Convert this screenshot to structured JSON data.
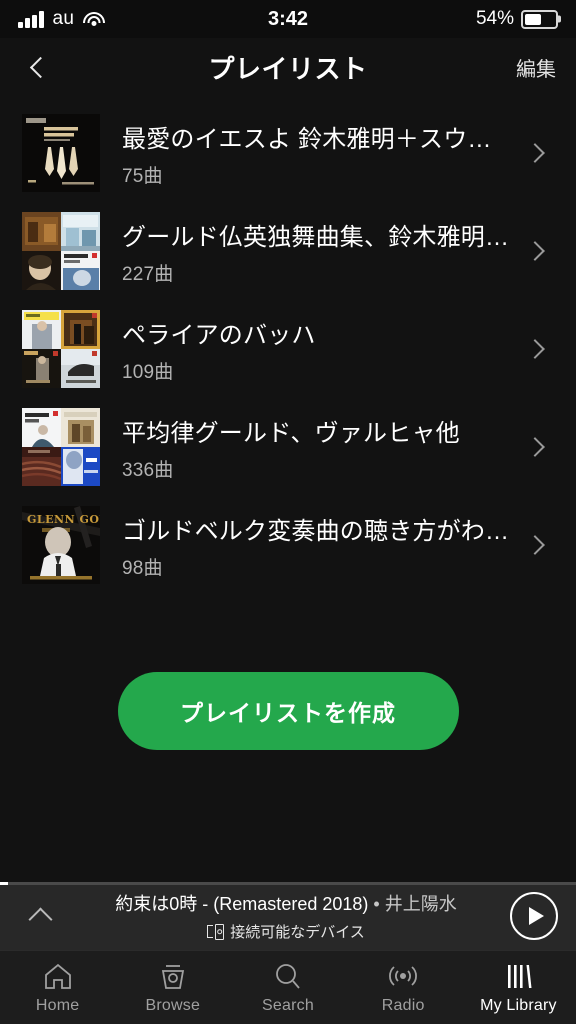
{
  "status_bar": {
    "carrier": "au",
    "time": "3:42",
    "battery_percent": "54%",
    "signal_icon": "signal-bars-icon",
    "wifi_icon": "wifi-icon",
    "battery_icon": "battery-icon"
  },
  "header": {
    "title": "プレイリスト",
    "back_icon": "chevron-left-icon",
    "edit_label": "編集"
  },
  "playlists": [
    {
      "title": "最愛のイエスよ 鈴木雅明＋スウ…",
      "tracks": "75曲",
      "cover": "organ-pipes-cover"
    },
    {
      "title": "グールド仏英独舞曲集、鈴木雅明…",
      "tracks": "227曲",
      "cover": "four-album-collage"
    },
    {
      "title": "ペライアのバッハ",
      "tracks": "109曲",
      "cover": "four-album-collage"
    },
    {
      "title": "平均律グールド、ヴァルヒャ他",
      "tracks": "336曲",
      "cover": "four-album-collage"
    },
    {
      "title": "ゴルドベルク変奏曲の聴き方がわ…",
      "tracks": "98曲",
      "cover": "glenn-gould-portrait-cover"
    }
  ],
  "create_button": {
    "label": "プレイリストを作成",
    "color": "#24a84c"
  },
  "now_playing": {
    "track": "約束は0時 - (Remastered 2018)",
    "separator": " • ",
    "artist": "井上陽水",
    "device_text": "接続可能なデバイス",
    "device_icon": "connect-device-icon",
    "expand_icon": "chevron-up-icon",
    "play_icon": "play-icon",
    "progress_percent": 1.4
  },
  "tabs": [
    {
      "label": "Home",
      "icon": "home-icon",
      "active": false
    },
    {
      "label": "Browse",
      "icon": "browse-icon",
      "active": false
    },
    {
      "label": "Search",
      "icon": "search-icon",
      "active": false
    },
    {
      "label": "Radio",
      "icon": "radio-icon",
      "active": false
    },
    {
      "label": "My Library",
      "icon": "library-icon",
      "active": true
    }
  ]
}
